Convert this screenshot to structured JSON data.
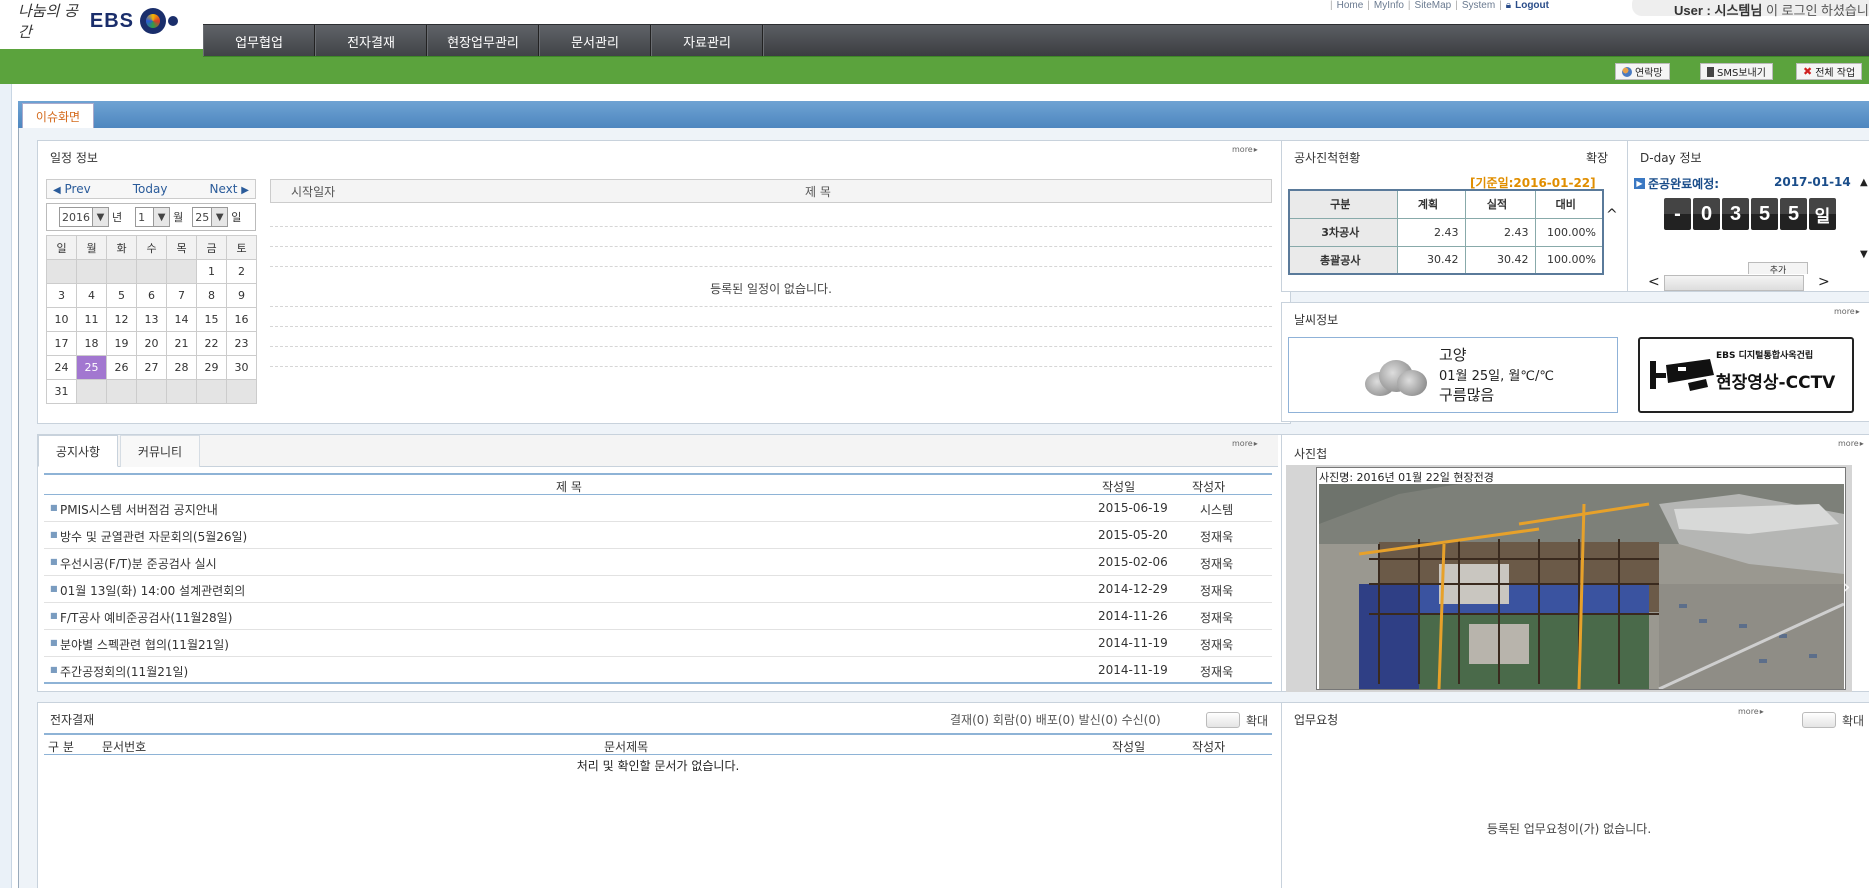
{
  "header": {
    "logo_slogan": "나눔의 공간",
    "logo_brand": "EBS",
    "top_links": [
      "Home",
      "MyInfo",
      "SiteMap",
      "System",
      "Logout"
    ],
    "user_label": "User :",
    "user_name": "시스템님",
    "user_suffix": "이 로그인 하셨습니다"
  },
  "nav": {
    "items": [
      "업무협업",
      "전자결재",
      "현장업무관리",
      "문서관리",
      "자료관리"
    ]
  },
  "toolbar": {
    "contacts": "연락망",
    "sms": "SMS보내기",
    "all_work": "전체 작업"
  },
  "issue_tab": "이슈화면",
  "schedule": {
    "title": "일정 정보",
    "more": "more",
    "prev": "Prev",
    "today": "Today",
    "next": "Next",
    "year": "2016",
    "year_unit": "년",
    "month": "1",
    "month_unit": "월",
    "day": "25",
    "day_unit": "일",
    "weekdays": [
      "일",
      "월",
      "화",
      "수",
      "목",
      "금",
      "토"
    ],
    "weeks": [
      [
        "",
        "",
        "",
        "",
        "",
        "1",
        "2"
      ],
      [
        "3",
        "4",
        "5",
        "6",
        "7",
        "8",
        "9"
      ],
      [
        "10",
        "11",
        "12",
        "13",
        "14",
        "15",
        "16"
      ],
      [
        "17",
        "18",
        "19",
        "20",
        "21",
        "22",
        "23"
      ],
      [
        "24",
        "25",
        "26",
        "27",
        "28",
        "29",
        "30"
      ],
      [
        "31",
        "",
        "",
        "",
        "",
        "",
        ""
      ]
    ],
    "col_start": "시작일자",
    "col_title": "제 목",
    "empty": "등록된 일정이 없습니다."
  },
  "progress": {
    "title": "공사진척현황",
    "expand": "확장",
    "base_date": "[기준일:2016-01-22]",
    "headers": [
      "구분",
      "계획",
      "실적",
      "대비"
    ],
    "rows": [
      [
        "3차공사",
        "2.43",
        "2.43",
        "100.00%"
      ],
      [
        "총괄공사",
        "30.42",
        "30.42",
        "100.00%"
      ]
    ]
  },
  "dday": {
    "title": "D-day 정보",
    "label": "준공완료예정:",
    "date": "2017-01-14",
    "digits": [
      "-",
      "0",
      "3",
      "5",
      "5",
      "일"
    ],
    "add_btn": "추가"
  },
  "weather": {
    "title": "날씨정보",
    "more": "more",
    "city": "고양",
    "date_line": "01월 25일, 월℃/℃",
    "condition": "구름많음",
    "cctv_top": "EBS 디지털통합사옥건립",
    "cctv_main": "현장영상-CCTV"
  },
  "notice": {
    "tab_notice": "공지사항",
    "tab_community": "커뮤니티",
    "more": "more",
    "col_title": "제 목",
    "col_date": "작성일",
    "col_author": "작성자",
    "rows": [
      {
        "title": "PMIS시스템 서버점검 공지안내",
        "date": "2015-06-19",
        "author": "시스템"
      },
      {
        "title": "방수 및 균열관련 자문회의(5월26일)",
        "date": "2015-05-20",
        "author": "정재욱"
      },
      {
        "title": "우선시공(F/T)분 준공검사 실시",
        "date": "2015-02-06",
        "author": "정재욱"
      },
      {
        "title": "01월 13일(화) 14:00 설계관련회의",
        "date": "2014-12-29",
        "author": "정재욱"
      },
      {
        "title": "F/T공사 예비준공검사(11월28일)",
        "date": "2014-11-26",
        "author": "정재욱"
      },
      {
        "title": "분야별 스펙관련 협의(11월21일)",
        "date": "2014-11-19",
        "author": "정재욱"
      },
      {
        "title": "주간공정회의(11월21일)",
        "date": "2014-11-19",
        "author": "정재욱"
      }
    ]
  },
  "photo": {
    "title": "사진첩",
    "more": "more",
    "caption": "사진명: 2016년 01월 22일 현장전경"
  },
  "approval": {
    "title": "전자결재",
    "counts": "결재(0)  회람(0)  배포(0)  발신(0)  수신(0)",
    "expand": "확대",
    "col_type": "구 분",
    "col_docno": "문서번호",
    "col_title": "문서제목",
    "col_date": "작성일",
    "col_author": "작성자",
    "empty": "처리 및 확인할 문서가 없습니다."
  },
  "request": {
    "title": "업무요청",
    "more": "more",
    "expand": "확대",
    "empty": "등록된 업무요청이(가) 없습니다."
  }
}
